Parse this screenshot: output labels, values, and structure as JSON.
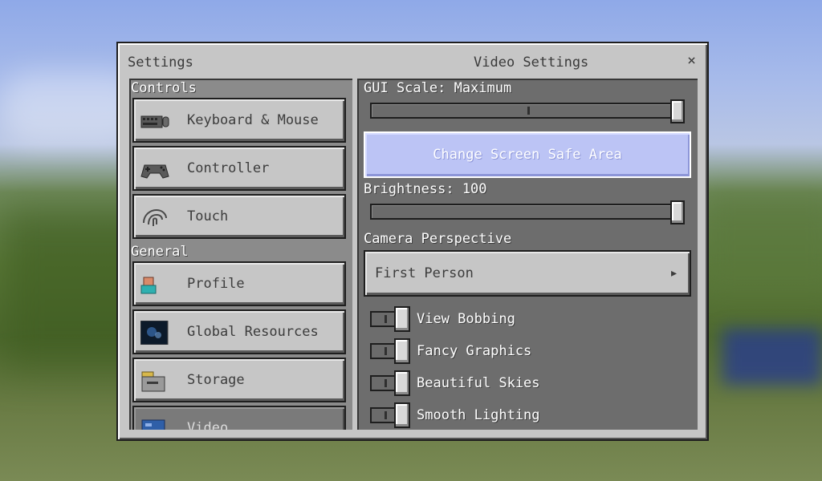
{
  "window": {
    "title_left": "Settings",
    "title_center": "Video Settings",
    "close_glyph": "×"
  },
  "sidebar": {
    "controls_label": "Controls",
    "general_label": "General",
    "controls_items": [
      {
        "label": "Keyboard & Mouse",
        "icon": "keyboard-icon"
      },
      {
        "label": "Controller",
        "icon": "controller-icon"
      },
      {
        "label": "Touch",
        "icon": "touch-icon"
      }
    ],
    "general_items": [
      {
        "label": "Profile",
        "icon": "profile-icon"
      },
      {
        "label": "Global Resources",
        "icon": "global-resources-icon"
      },
      {
        "label": "Storage",
        "icon": "storage-icon"
      },
      {
        "label": "Video",
        "icon": "video-icon",
        "selected": true
      }
    ]
  },
  "video": {
    "gui_scale_label": "GUI Scale: Maximum",
    "gui_scale_value": 1.0,
    "safe_area_button": "Change Screen Safe Area",
    "brightness_label": "Brightness: 100",
    "brightness_value": 100,
    "camera_label": "Camera Perspective",
    "camera_value": "First Person",
    "toggles": [
      {
        "label": "View Bobbing",
        "on": false
      },
      {
        "label": "Fancy Graphics",
        "on": false
      },
      {
        "label": "Beautiful Skies",
        "on": false
      },
      {
        "label": "Smooth Lighting",
        "on": false
      }
    ]
  },
  "colors": {
    "panel": "#c6c6c6",
    "accent_button": "#bcc4f5"
  }
}
